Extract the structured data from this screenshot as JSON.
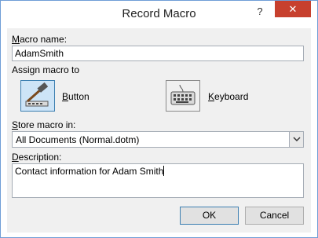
{
  "window": {
    "title": "Record Macro",
    "help_glyph": "?",
    "close_glyph": "✕"
  },
  "macro_name": {
    "label": "Macro name:",
    "value": "AdamSmith"
  },
  "assign": {
    "label": "Assign macro to",
    "button_label": "Button",
    "keyboard_label": "Keyboard"
  },
  "store": {
    "label": "Store macro in:",
    "value": "All Documents (Normal.dotm)"
  },
  "description": {
    "label": "Description:",
    "value": "Contact information for Adam Smith"
  },
  "buttons": {
    "ok": "OK",
    "cancel": "Cancel"
  },
  "colors": {
    "close_bg": "#c7402e",
    "selected_bg": "#cde4f7",
    "border_accent": "#6f9ed6"
  },
  "icons": [
    "help-icon",
    "close-icon",
    "button-hammer-icon",
    "keyboard-icon",
    "chevron-down-icon"
  ]
}
